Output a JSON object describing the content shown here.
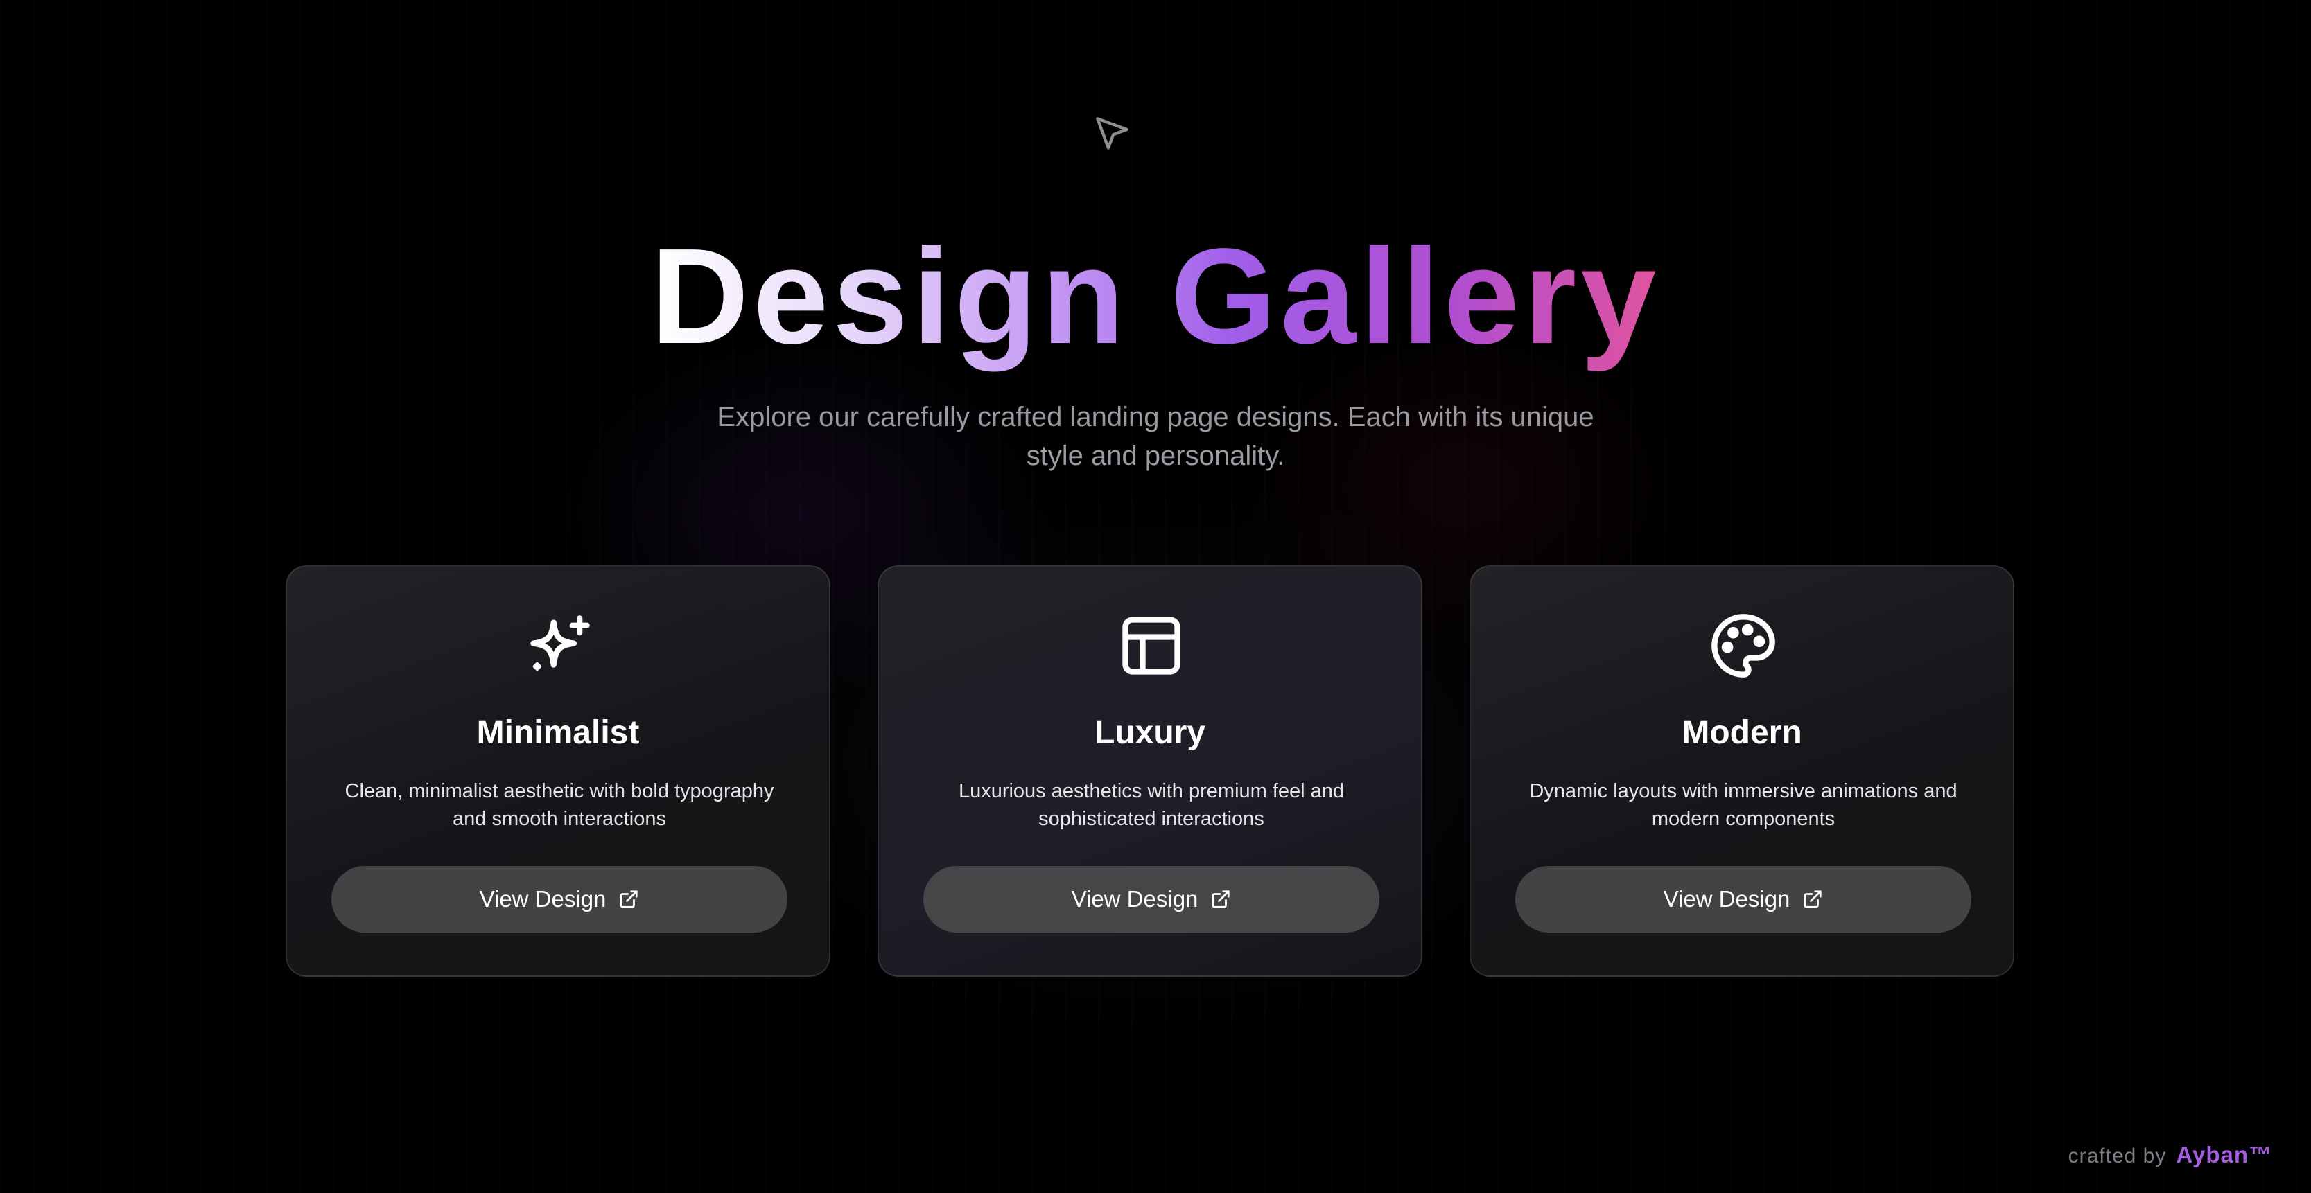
{
  "hero": {
    "title_part1": "Design",
    "title_part2": "Gallery",
    "subtitle": "Explore our carefully crafted landing page designs. Each with its unique style and personality."
  },
  "icons": {
    "cursor": "cursor-arrow-icon",
    "minimalist": "sparkles-icon",
    "luxury": "layout-panel-icon",
    "modern": "palette-icon",
    "external": "external-link-icon"
  },
  "cards": [
    {
      "title": "Minimalist",
      "description": "Clean, minimalist aesthetic with bold typography and smooth interactions",
      "button_label": "View Design"
    },
    {
      "title": "Luxury",
      "description": "Luxurious aesthetics with premium feel and sophisticated interactions",
      "button_label": "View Design"
    },
    {
      "title": "Modern",
      "description": "Dynamic layouts with immersive animations and modern components",
      "button_label": "View Design"
    }
  ],
  "footer": {
    "prefix": "crafted by",
    "brand": "Ayban™"
  },
  "colors": {
    "background": "#000000",
    "card_bg": "#1c1c20",
    "button_bg": "#434345",
    "gradient_start": "#ffffff",
    "gradient_mid": "#a15ee8",
    "gradient_end": "#e0549e",
    "brand": "#a55de4"
  }
}
